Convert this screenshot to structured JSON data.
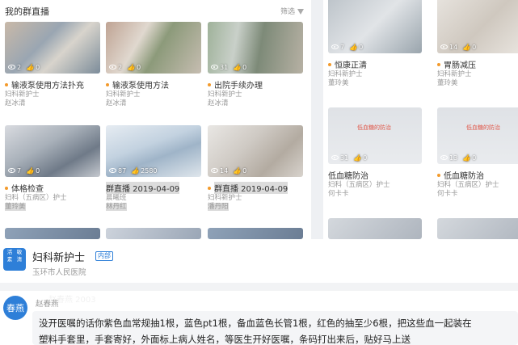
{
  "left_panel": {
    "title": "我的群直播",
    "filter_label": "筛选",
    "cards": [
      {
        "views": "2",
        "likes": "0",
        "title": "输液泵使用方法扑充",
        "sub1": "妇科新护士",
        "sub2": "赵冰清"
      },
      {
        "views": "2",
        "likes": "0",
        "title": "输液泵使用方法",
        "sub1": "妇科新护士",
        "sub2": "赵冰清"
      },
      {
        "views": "31",
        "likes": "0",
        "title": "出院手续办理",
        "sub1": "妇科新护士",
        "sub2": "赵冰清"
      },
      {
        "views": "7",
        "likes": "0",
        "title": "体格检查",
        "sub1": "妇科（五病区）护士",
        "sub2": "董玲美"
      },
      {
        "views": "87",
        "likes": "2580",
        "title": "群直播 2019-04-09",
        "sub1": "晨曦班",
        "sub2": "林丹红"
      },
      {
        "views": "14",
        "likes": "0",
        "title": "群直播 2019-04-09",
        "sub1": "妇科新护士",
        "sub2": "潘丹阳"
      }
    ]
  },
  "right_panel": {
    "cards": [
      {
        "views": "7",
        "likes": "0",
        "title": "恒康正清",
        "sub1": "妇科新护士",
        "sub2": "董玲美"
      },
      {
        "views": "14",
        "likes": "0",
        "title": "胃肠减压",
        "sub1": "妇科新护士",
        "sub2": "董玲美"
      },
      {
        "views": "31",
        "likes": "0",
        "title": "低血糖防治",
        "sub1": "妇科（五病区）护士",
        "sub2": "何卡卡",
        "slide_text": "低血糖的防治"
      },
      {
        "views": "13",
        "likes": "0",
        "title": "低血糖防治",
        "sub1": "妇科（五病区）护士",
        "sub2": "何卡卡",
        "slide_text": "低血糖的防治"
      }
    ]
  },
  "group": {
    "logo_chars": [
      "活",
      "敏",
      "素",
      "清"
    ],
    "name": "妇科新护士",
    "badge": "内部",
    "org": "玉环市人民医院"
  },
  "message": {
    "avatar_text": "春燕",
    "sender": "赵春燕",
    "line1": "没开医嘱的话你紫色血常规抽1根，蓝色pt1根，备血蓝色长管1根，红色的抽至少6根，把这些血一起装在",
    "line2": "塑料手套里，手套寄好，外面标上病人姓名，等医生开好医嘱，条码打出来后，贴好马上送"
  }
}
